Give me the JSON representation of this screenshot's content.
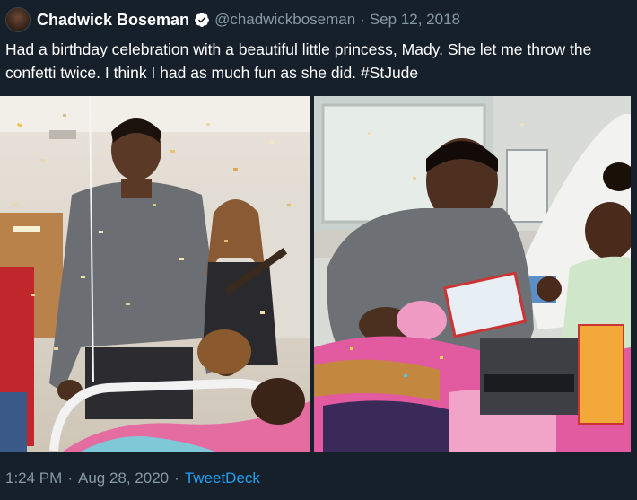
{
  "author": {
    "name": "Chadwick Boseman",
    "handle": "@chadwickboseman",
    "date": "Sep 12, 2018",
    "avatar_icon": "profile-photo",
    "verified_icon": "verified-badge-icon"
  },
  "tweet": {
    "text": "Had a birthday celebration with a beautiful little princess, Mady. She let me throw the confetti twice. I think I had as much fun as she did.",
    "hashtag": "#StJude"
  },
  "media": {
    "photos": [
      {
        "icon": "photo-birthday-confetti"
      },
      {
        "icon": "photo-hospital-bed-toys"
      }
    ]
  },
  "footer": {
    "time": "1:24 PM",
    "date": "Aug 28, 2020",
    "separator": "·",
    "source": "TweetDeck"
  },
  "colors": {
    "background": "#15202b",
    "secondary_text": "#8899a6",
    "link": "#1da1f2",
    "verified": "#1da1f2"
  }
}
